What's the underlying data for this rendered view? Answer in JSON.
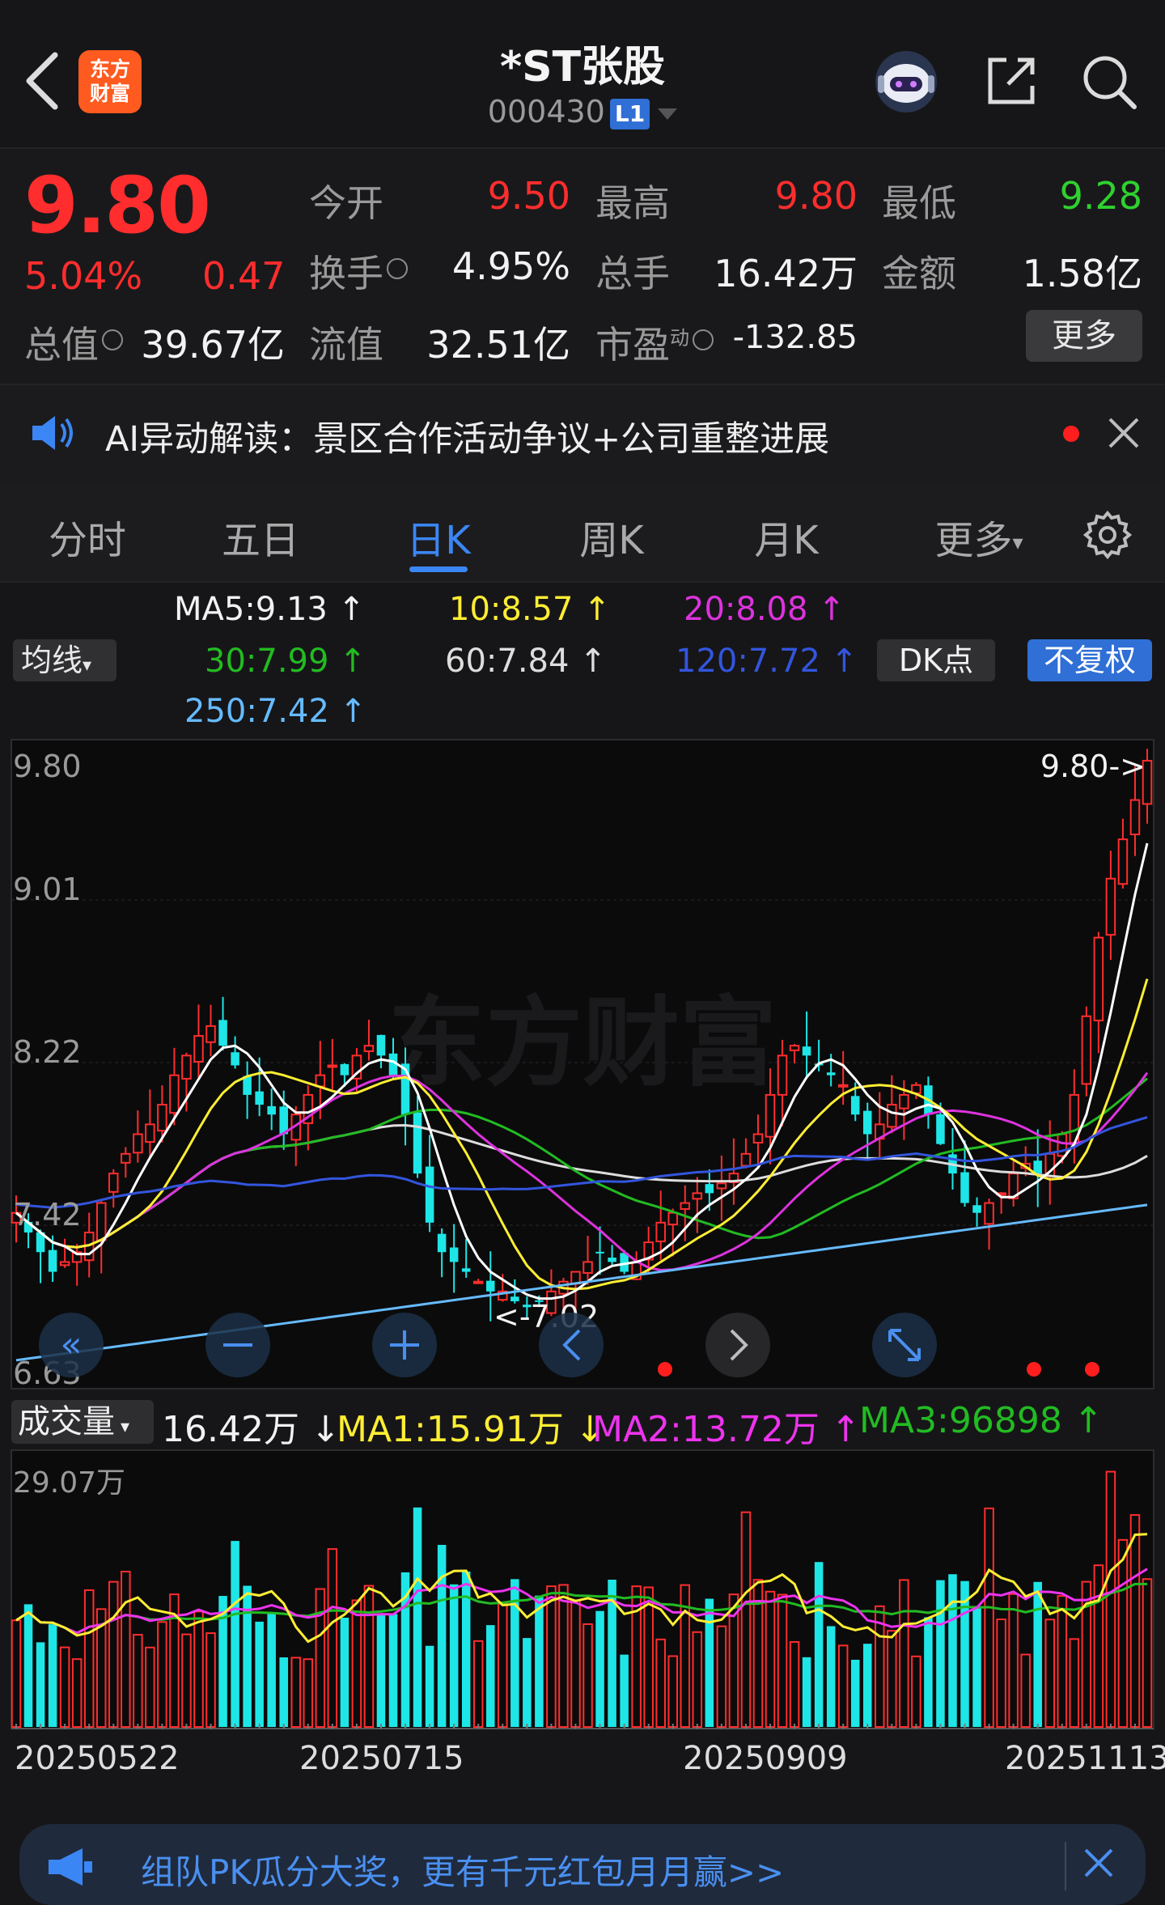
{
  "header": {
    "title": "*ST张股",
    "code": "000430",
    "level_badge": "L1",
    "logo_line1": "东方",
    "logo_line2": "财富"
  },
  "quote": {
    "price": "9.80",
    "change_pct": "5.04%",
    "change": "0.47",
    "open_label": "今开",
    "open": "9.50",
    "high_label": "最高",
    "high": "9.80",
    "low_label": "最低",
    "low": "9.28",
    "turnover_label": "换手",
    "turnover": "4.95%",
    "volume_label": "总手",
    "volume": "16.42万",
    "amount_label": "金额",
    "amount": "1.58亿",
    "mktcap_label": "总值",
    "mktcap": "39.67亿",
    "float_label": "流值",
    "float": "32.51亿",
    "pe_label": "市盈",
    "pe_sup": "动",
    "pe": "-132.85",
    "more_label": "更多"
  },
  "news": {
    "text": "AI异动解读：景区合作活动争议+公司重整进展"
  },
  "tabs": [
    {
      "label": "分时"
    },
    {
      "label": "五日"
    },
    {
      "label": "日K"
    },
    {
      "label": "周K"
    },
    {
      "label": "月K"
    },
    {
      "label": "更多"
    }
  ],
  "active_tab": "日K",
  "ma_legend": {
    "button": "均线",
    "ma5": "MA5:9.13 ↑",
    "ma10": "10:8.57 ↑",
    "ma20": "20:8.08 ↑",
    "ma30": "30:7.99 ↑",
    "ma60": "60:7.84 ↑",
    "ma120": "120:7.72 ↑",
    "ma250": "250:7.42 ↑",
    "dk_button": "DK点",
    "fq_button": "不复权"
  },
  "price_axis": [
    "9.80",
    "9.01",
    "8.22",
    "7.42",
    "6.63"
  ],
  "price_marks": {
    "high_mark": "9.80->",
    "low_mark": "<-7.02"
  },
  "watermark": "东方财富",
  "volume_legend": {
    "button": "成交量",
    "vol": "16.42万 ↓",
    "ma1": "MA1:15.91万 ↓",
    "ma2": "MA2:13.72万 ↑",
    "ma3": "MA3:96898 ↑"
  },
  "volume_axis_max": "29.07万",
  "dates": [
    "20250522",
    "20250715",
    "20250909",
    "20251113"
  ],
  "banner": {
    "text": "组队PK瓜分大奖，更有千元红包月月赢>>"
  },
  "colors": {
    "up": "#ff2d2d",
    "down": "#1ee6e6",
    "ma5": "#ffffff",
    "ma10": "#ffee33",
    "ma20": "#dd33dd",
    "ma30": "#22bb22",
    "ma60": "#dddddd",
    "ma120": "#3355dd",
    "ma250": "#66bbff",
    "accent": "#3b86f5"
  },
  "chart_data": {
    "type": "candlestick",
    "x_start": "20250522",
    "x_end": "20251113",
    "ylim": [
      6.63,
      9.8
    ],
    "close": [
      7.5,
      7.4,
      7.3,
      7.2,
      7.25,
      7.3,
      7.4,
      7.55,
      7.7,
      7.8,
      7.9,
      7.95,
      8.05,
      8.2,
      8.3,
      8.4,
      8.45,
      8.35,
      8.25,
      8.1,
      8.05,
      8.0,
      7.9,
      8.0,
      8.1,
      8.2,
      8.25,
      8.2,
      8.3,
      8.35,
      8.3,
      8.2,
      8.0,
      7.7,
      7.45,
      7.3,
      7.25,
      7.2,
      7.15,
      7.1,
      7.1,
      7.05,
      7.02,
      7.05,
      7.1,
      7.15,
      7.2,
      7.25,
      7.3,
      7.25,
      7.2,
      7.25,
      7.35,
      7.45,
      7.5,
      7.55,
      7.6,
      7.6,
      7.65,
      7.7,
      7.8,
      7.9,
      8.1,
      8.3,
      8.35,
      8.3,
      8.25,
      8.2,
      8.15,
      8.0,
      7.9,
      7.95,
      8.05,
      8.1,
      8.15,
      8.0,
      7.85,
      7.7,
      7.55,
      7.5,
      7.55,
      7.6,
      7.7,
      7.75,
      7.7,
      7.8,
      7.9,
      8.1,
      8.5,
      8.9,
      9.2,
      9.4,
      9.6,
      9.8
    ],
    "volume_max_label": "29.07万"
  }
}
